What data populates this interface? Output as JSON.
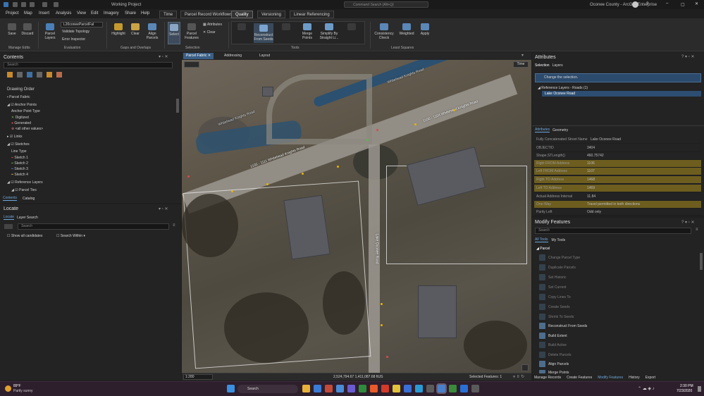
{
  "title": {
    "project": "Working Project",
    "search_placeholder": "Command Search (Alt+Q)",
    "portal": "Oconee County - ArcGIS Enterprise"
  },
  "menu": [
    "Project",
    "Map",
    "Insert",
    "Analysis",
    "View",
    "Edit",
    "Imagery",
    "Share",
    "Help"
  ],
  "context_tabs": [
    "Time",
    "Parcel Record Workflows",
    "Quality",
    "Versioning",
    "Linear Referencing"
  ],
  "ribbon": {
    "save": "Save",
    "discard": "Discard",
    "manage_edits": "Manage Edits",
    "parcel_layers": "Parcel Layers",
    "parcel_dropdown": "L20coneeParcelFal",
    "validate_topology": "Validate Topology",
    "error_inspector": "Error Inspector",
    "evaluation": "Evaluation",
    "highlight": "Highlight",
    "clear": "Clear",
    "align_parcels": "Align Parcels",
    "gaps_overlaps": "Gaps and Overlaps",
    "select": "Select",
    "parcel_features": "Parcel Features",
    "attributes": "Attributes",
    "clear2": "Clear",
    "selection": "Selection",
    "tools": [
      "Reconstruct From Seeds",
      "Merge Points",
      "Simplify By Straight Li..."
    ],
    "tools_group": "Tools",
    "consistency_check": "Consistency Check",
    "weighted": "Weighted",
    "apply": "Apply",
    "least_squares": "Least Squares"
  },
  "contents": {
    "title": "Contents",
    "search": "Search",
    "drawing_order": "Drawing Order",
    "items": [
      "Parcel Fabric",
      "Anchor Points",
      "Anchor Point Type",
      "Digitized",
      "Generated",
      "<all other values>",
      "Links",
      "Sketches",
      "Line Type",
      "Sketch 1",
      "Sketch 2",
      "Sketch 3",
      "Sketch 4",
      "Reference Layers",
      "Parcel Ties"
    ],
    "tabs": [
      "Contents",
      "Catalog"
    ]
  },
  "locate": {
    "title": "Locate",
    "tabs": [
      "Locate",
      "Layer Search"
    ],
    "search": "Search",
    "show_all": "Show all candidates",
    "search_within": "Search Within"
  },
  "map": {
    "tabs": [
      "Parcel Fabric",
      "Addressing",
      "Layout"
    ],
    "time_btn": "Time",
    "road_labels": [
      "1100 - 1104 Whitehead Knights Road",
      "1103 - 1111 Whitehead Knights Road",
      "Lake Oconee Road",
      "Whitehead Knights Road"
    ],
    "scale": "1:280",
    "coords": "2,524,794.67 1,411,087.68 ftUS",
    "selected_features": "Selected Features: 1"
  },
  "attributes_pane": {
    "title": "Attributes",
    "tabs": [
      "Selection",
      "Layers"
    ],
    "change_selection": "Change the selection.",
    "ref_layers": "Reference Layers - Roads (1)",
    "selected_road": "Lake Oconee Road",
    "sub_tabs": [
      "Attributes",
      "Geometry"
    ],
    "rows": [
      {
        "k": "Fully Concatenated Street Name",
        "v": "Lake Oconee Road"
      },
      {
        "k": "OBJECTID",
        "v": "3404"
      },
      {
        "k": "Shape.STLength()",
        "v": "460.75742"
      },
      {
        "k": "Right FROM Address",
        "v": "1106"
      },
      {
        "k": "Left FROM Address",
        "v": "1107"
      },
      {
        "k": "Right TO Address",
        "v": "1468"
      },
      {
        "k": "Left TO Address",
        "v": "1469"
      },
      {
        "k": "Actual Address Interval",
        "v": "11.84"
      },
      {
        "k": "One-Way",
        "v": "Travel permitted in both directions"
      },
      {
        "k": "Parity Left",
        "v": "Odd only"
      }
    ]
  },
  "modify": {
    "title": "Modify Features",
    "search": "Search",
    "tabs": [
      "All Tools",
      "My Tools"
    ],
    "group": "Parcel",
    "tools": [
      "Change Parcel Type",
      "Duplicate Parcels",
      "Set Historic",
      "Set Current",
      "Copy Lines To",
      "Create Seeds",
      "Shrink To Seeds",
      "Reconstruct From Seeds",
      "Build Extent",
      "Build Active",
      "Delete Parcels",
      "Align Parcels",
      "Merge Points"
    ]
  },
  "bottom_tabs": [
    "Manage Records",
    "Create Features",
    "Modify Features",
    "History",
    "Export"
  ],
  "taskbar": {
    "weather_temp": "89°F",
    "weather_desc": "Partly sunny",
    "search": "Search",
    "time": "2:30 PM",
    "date": "7/23/2020"
  }
}
